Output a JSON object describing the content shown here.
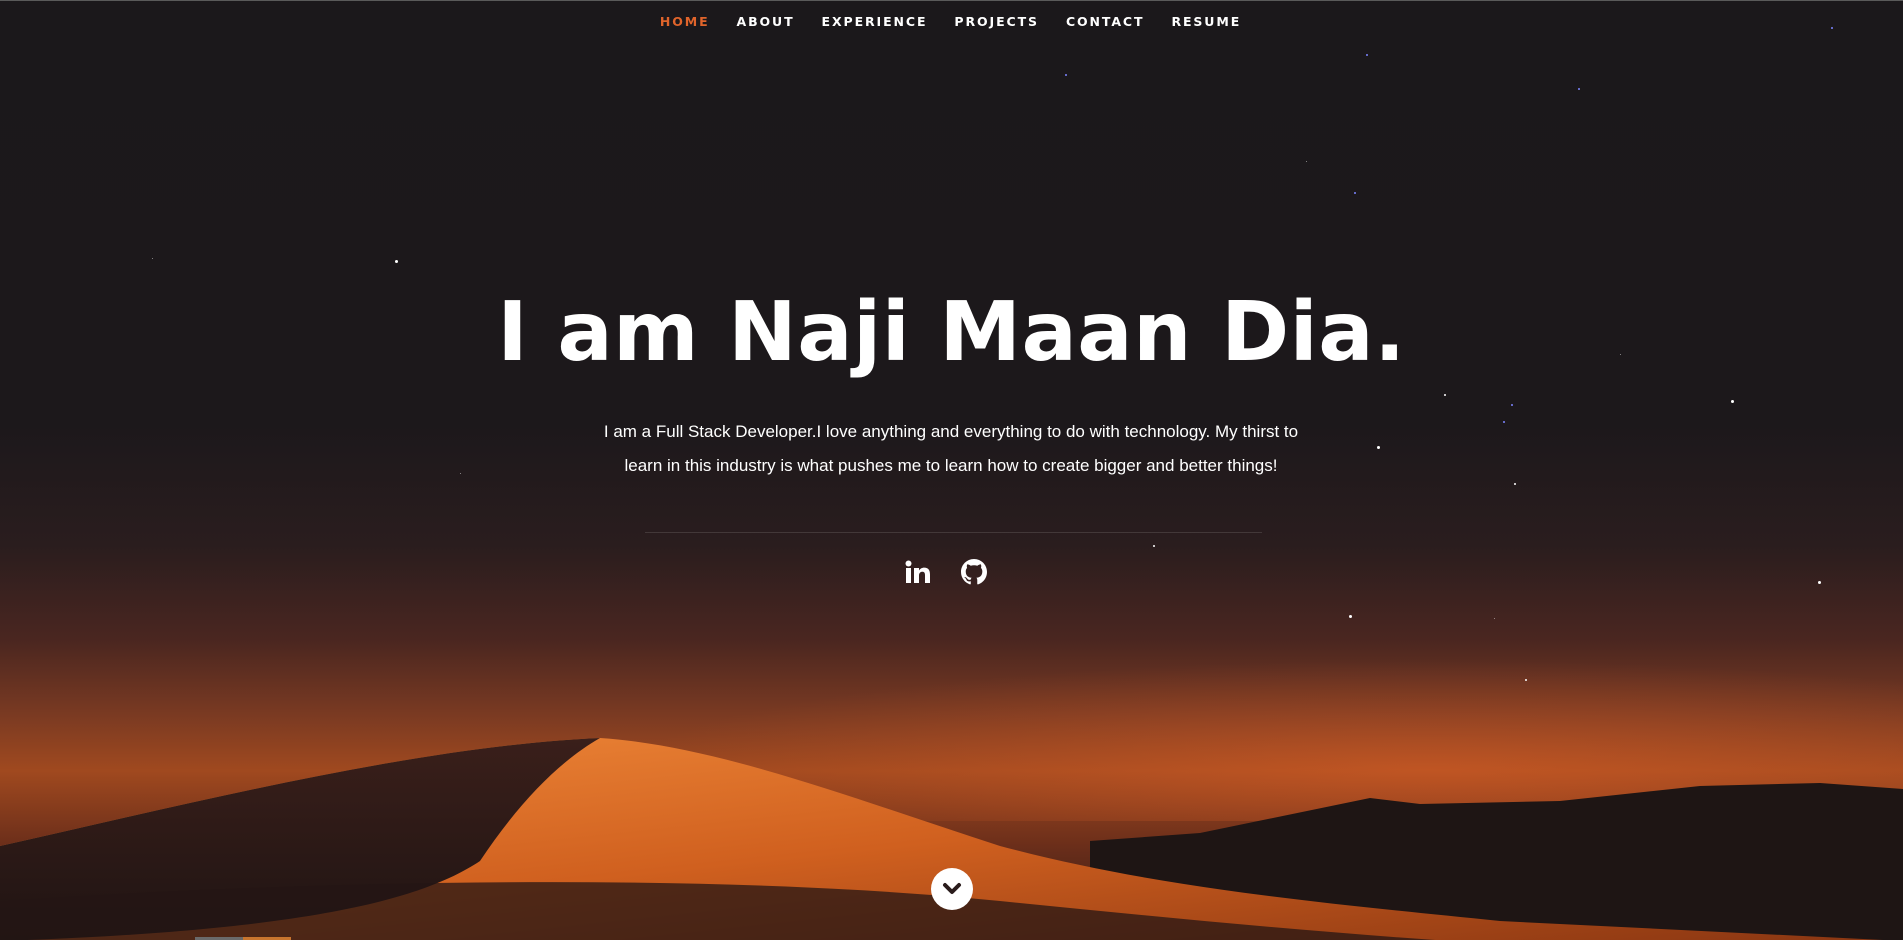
{
  "nav": {
    "items": [
      {
        "label": "HOME",
        "active": true
      },
      {
        "label": "ABOUT",
        "active": false
      },
      {
        "label": "EXPERIENCE",
        "active": false
      },
      {
        "label": "PROJECTS",
        "active": false
      },
      {
        "label": "CONTACT",
        "active": false
      },
      {
        "label": "RESUME",
        "active": false
      }
    ]
  },
  "hero": {
    "title": "I am Naji Maan Dia.",
    "bio": "I am a Full Stack Developer.I love anything and everything to do with technology. My thirst to learn in this industry is what pushes me to learn how to create bigger and better things!"
  },
  "social": {
    "icons": [
      "linkedin-icon",
      "github-icon"
    ]
  },
  "scroll": {
    "icon": "chevron-down-icon"
  },
  "colors": {
    "accent": "#e0642b",
    "text": "#ffffff",
    "background": "#1a181b"
  }
}
